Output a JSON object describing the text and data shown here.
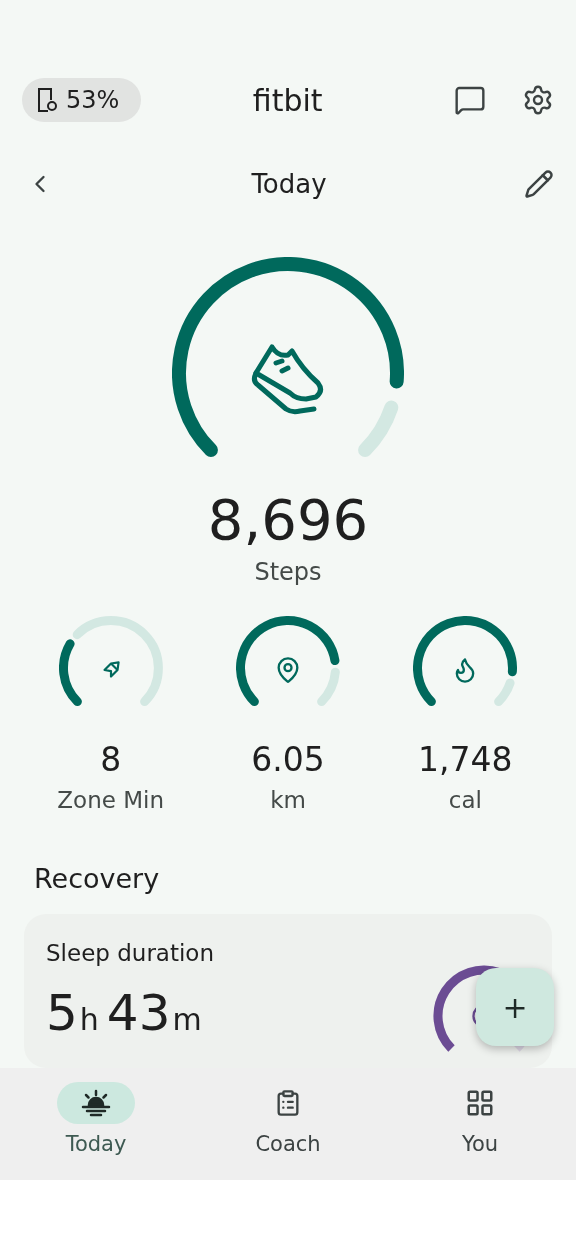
{
  "header": {
    "battery": "53%",
    "title": "fitbit"
  },
  "date_bar": {
    "title": "Today"
  },
  "steps": {
    "value": "8,696",
    "label": "Steps"
  },
  "stats": [
    {
      "kind": "zone",
      "value": "8",
      "label": "Zone Min"
    },
    {
      "kind": "distance",
      "value": "6.05",
      "label": "km"
    },
    {
      "kind": "calories",
      "value": "1,748",
      "label": "cal"
    }
  ],
  "recovery": {
    "title": "Recovery",
    "card": {
      "title": "Sleep duration",
      "parts": [
        {
          "value": "5",
          "unit": "h"
        },
        {
          "value": "43",
          "unit": "m"
        }
      ]
    }
  },
  "fab": {
    "label": "+"
  },
  "nav": [
    {
      "kind": "today",
      "label": "Today",
      "selected": true
    },
    {
      "kind": "coach",
      "label": "Coach",
      "selected": false
    },
    {
      "kind": "you",
      "label": "You",
      "selected": false
    }
  ]
}
